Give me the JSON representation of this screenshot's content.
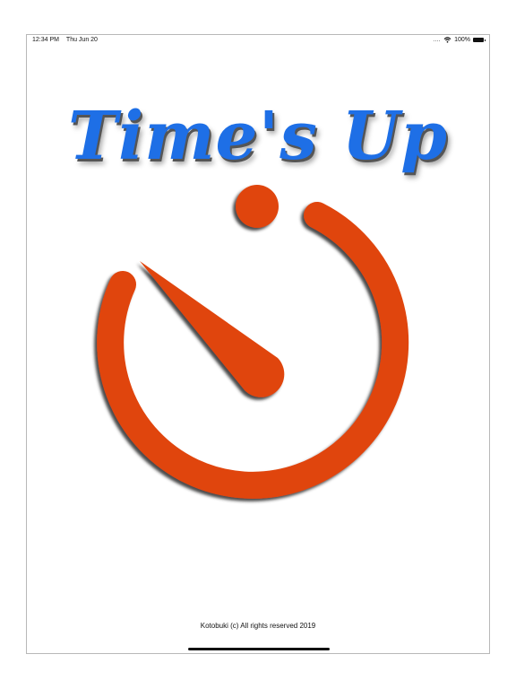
{
  "status_bar": {
    "time": "12:34 PM",
    "date": "Thu Jun 20",
    "battery_text": "100%",
    "battery_level": 1.0
  },
  "app": {
    "title": "Time's Up",
    "footer": "Kotobuki (c) All rights reserved 2019"
  },
  "icons": {
    "wifi": "wifi-icon",
    "battery": "battery-icon",
    "signal": "cellular-dots-icon",
    "logo": "stopwatch-icon"
  },
  "colors": {
    "title": "#1e6fe6",
    "logo": "#e0440a",
    "background": "#ffffff"
  }
}
